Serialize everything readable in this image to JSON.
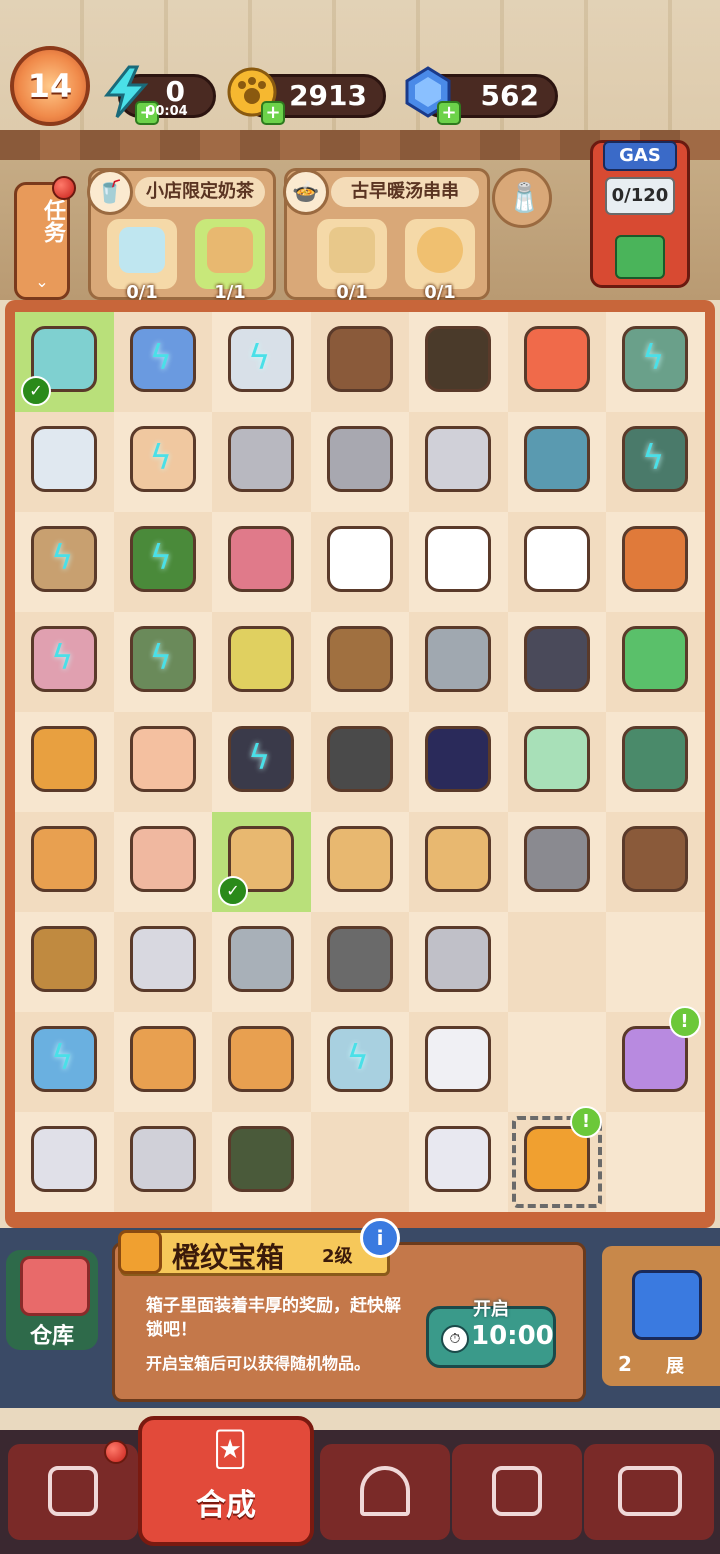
{
  "hud": {
    "level": "14",
    "energy": "0",
    "energy_timer": "00:04",
    "coins": "2913",
    "gems": "562"
  },
  "tasks": {
    "button_label": "任务",
    "orders": [
      {
        "title": "小店限定奶茶",
        "slots": [
          {
            "count": "0/1"
          },
          {
            "count": "1/1"
          }
        ]
      },
      {
        "title": "古早暖汤串串",
        "slots": [
          {
            "count": "0/1"
          },
          {
            "count": "0/1"
          }
        ]
      }
    ]
  },
  "gas": {
    "label": "GAS",
    "meter": "0/120"
  },
  "board": {
    "rows": 9,
    "cols": 7,
    "items": [
      "jar-green",
      "notebook",
      "basket-paper",
      "shelf",
      "soy-bottle",
      "star",
      "pot-green",
      "bottles",
      "lucky-cat",
      "silver-bar",
      "silver-bars",
      "metal-plates",
      "noodle-bowl",
      "hotpot",
      "cart",
      "plant",
      "brush",
      "chef-hat-1",
      "chef-hat-2",
      "chef-hat-3",
      "shrimp-bowl",
      "can",
      "bike",
      "paint-box",
      "wood-pieces",
      "kunai",
      "sugarcane",
      "gum",
      "skewer-box",
      "envelope-open",
      "sugarcane-bundle",
      "tires",
      "ink-bottle",
      "glue-502",
      "hand-truck",
      "skewer-cards",
      "envelope",
      "delivery-bag-1",
      "delivery-bag-2",
      "delivery-bag-3",
      "wrench",
      "grill-food",
      "mallet",
      "paper-stack",
      "teapot",
      "hook",
      "gear",
      "",
      "",
      "fridge",
      "skewer-cards-2",
      "skewer-card",
      "ice-plant",
      "paper-sheet",
      "",
      "gift-box-purple",
      "toaster",
      "printer",
      "bamboo-plant",
      "",
      "paper-pile",
      "chest-orange",
      ""
    ]
  },
  "info": {
    "title": "橙纹宝箱",
    "level": "2级",
    "desc": "箱子里面装着丰厚的奖励，赶快解锁吧！",
    "desc2": "开启宝箱后可以获得随机物品。",
    "open_label": "开启",
    "open_time": "10:00",
    "warehouse_label": "仓库",
    "side_count": "2",
    "side_label": "展"
  },
  "nav": {
    "active_label": "合成"
  },
  "colors": {
    "board_border": "#c8663a",
    "cell_light": "#f7e6cf",
    "selected": "#b9e07a",
    "energy_bolt": "#4ae0e8"
  }
}
